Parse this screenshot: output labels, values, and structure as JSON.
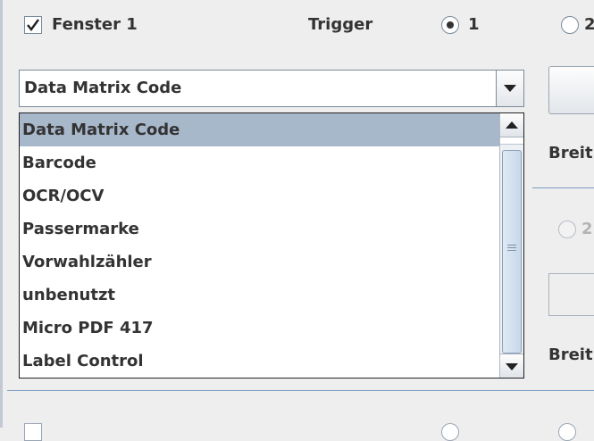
{
  "window1": {
    "checkbox_label": "Fenster 1",
    "checked": true
  },
  "trigger": {
    "label": "Trigger",
    "option_1": "1",
    "option_2": "2",
    "selected": "1"
  },
  "combo": {
    "selected": "Data Matrix Code",
    "options": [
      "Data Matrix Code",
      "Barcode",
      "OCR/OCV",
      "Passermarke",
      "Vorwahlzähler",
      "unbenutzt",
      "Micro PDF 417",
      "Label Control"
    ]
  },
  "right_panel": {
    "breite_1": "Breit",
    "radio_label": "2",
    "breite_2": "Breit"
  },
  "icons": {
    "checkbox": "check-icon",
    "combo_arrow": "chevron-down-icon",
    "scroll_up": "arrow-up-icon",
    "scroll_down": "arrow-down-icon"
  },
  "colors": {
    "background": "#eeeeee",
    "selection": "#a8b8cb",
    "separator": "#7c9cc4",
    "text": "#333333"
  }
}
